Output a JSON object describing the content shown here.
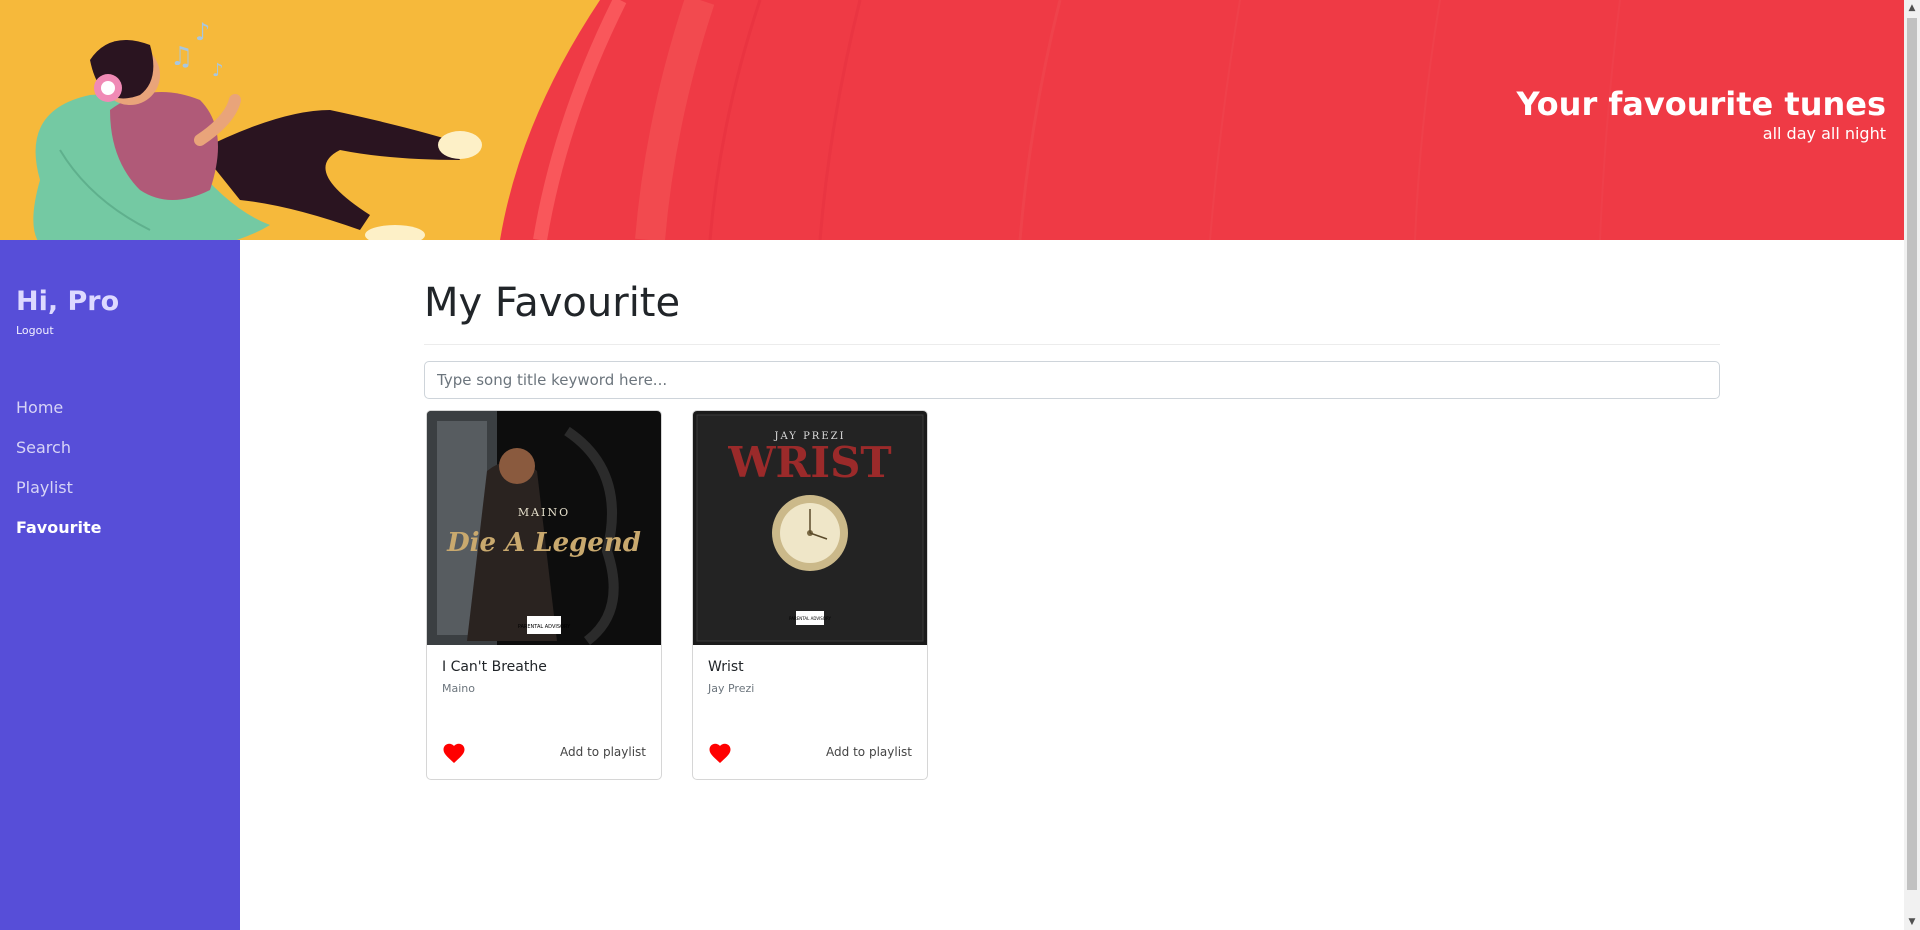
{
  "banner": {
    "title": "Your favourite tunes",
    "subtitle": "all day all night",
    "illustration": "girl-with-headphones-on-beanbag",
    "colors": {
      "yellow": "#f6b93b",
      "red": "#ef3a45"
    }
  },
  "sidebar": {
    "greeting": "Hi, Pro",
    "logout_label": "Logout",
    "items": [
      {
        "label": "Home",
        "active": false
      },
      {
        "label": "Search",
        "active": false
      },
      {
        "label": "Playlist",
        "active": false
      },
      {
        "label": "Favourite",
        "active": true
      }
    ],
    "background": "#574ed8"
  },
  "main": {
    "title": "My Favourite",
    "search_placeholder": "Type song title keyword here...",
    "cards": [
      {
        "title": "I Can't Breathe",
        "artist": "Maino",
        "cover_text_top": "MAINO",
        "cover_text_main": "Die A Legend",
        "cover_badge": "PARENTAL ADVISORY",
        "favourite": true,
        "action_label": "Add to playlist"
      },
      {
        "title": "Wrist",
        "artist": "Jay Prezi",
        "cover_text_top": "JAY PREZI",
        "cover_text_main": "WRIST",
        "cover_badge": "PARENTAL ADVISORY",
        "favourite": true,
        "action_label": "Add to playlist"
      }
    ],
    "heart_color": "#ff0000"
  }
}
